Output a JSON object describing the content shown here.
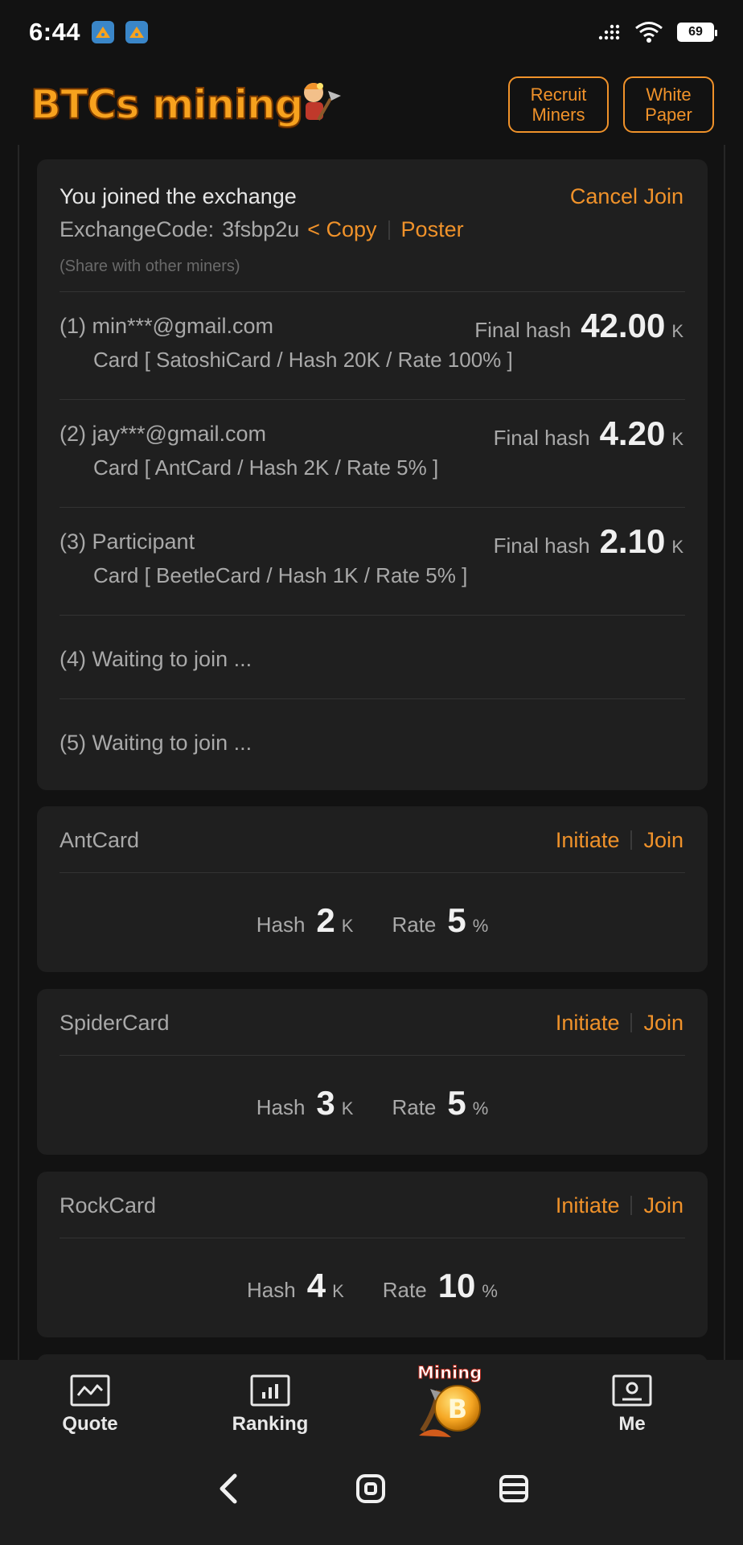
{
  "status": {
    "time": "6:44",
    "battery": "69"
  },
  "header": {
    "logo_text": "BTCs mining",
    "recruit_label": "Recruit Miners",
    "whitepaper_label": "White Paper"
  },
  "exchange": {
    "title": "You joined the exchange",
    "cancel_label": "Cancel Join",
    "code_label": "ExchangeCode:",
    "code_value": "3fsbp2u",
    "copy_label": "< Copy",
    "poster_label": "Poster",
    "share_hint": "(Share with other miners)",
    "final_hash_label": "Final hash",
    "participants": [
      {
        "name": "(1) min***@gmail.com",
        "hash": "42.00",
        "unit": "K",
        "card": "Card [ SatoshiCard / Hash 20K / Rate 100% ]"
      },
      {
        "name": "(2) jay***@gmail.com",
        "hash": "4.20",
        "unit": "K",
        "card": "Card [ AntCard / Hash 2K / Rate 5% ]"
      },
      {
        "name": "(3) Participant",
        "hash": "2.10",
        "unit": "K",
        "card": "Card [ BeetleCard / Hash 1K / Rate 5% ]"
      }
    ],
    "waiting": [
      "(4) Waiting to join ...",
      "(5) Waiting to join ..."
    ]
  },
  "cards": [
    {
      "name": "AntCard",
      "initiate": "Initiate",
      "join": "Join",
      "hash_label": "Hash",
      "hash": "2",
      "hash_unit": "K",
      "rate_label": "Rate",
      "rate": "5",
      "rate_unit": "%"
    },
    {
      "name": "SpiderCard",
      "initiate": "Initiate",
      "join": "Join",
      "hash_label": "Hash",
      "hash": "3",
      "hash_unit": "K",
      "rate_label": "Rate",
      "rate": "5",
      "rate_unit": "%"
    },
    {
      "name": "RockCard",
      "initiate": "Initiate",
      "join": "Join",
      "hash_label": "Hash",
      "hash": "4",
      "hash_unit": "K",
      "rate_label": "Rate",
      "rate": "10",
      "rate_unit": "%"
    }
  ],
  "nav": {
    "quote": "Quote",
    "ranking": "Ranking",
    "mining": "Mining",
    "me": "Me"
  },
  "colors": {
    "accent": "#f0922a",
    "background": "#121212",
    "card": "#1f1f1f"
  }
}
